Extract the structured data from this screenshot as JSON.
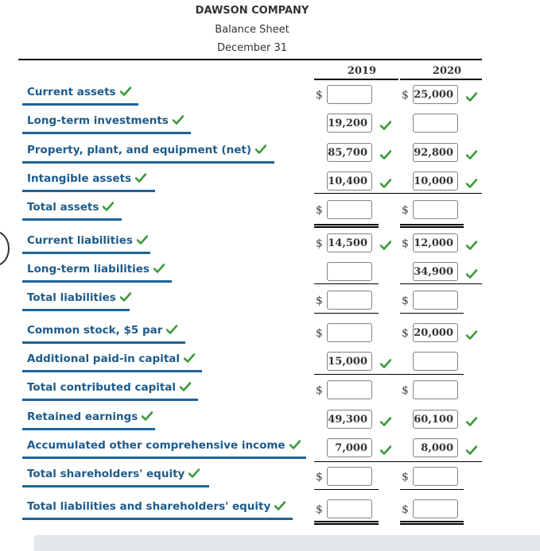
{
  "header": {
    "company": "DAWSON COMPANY",
    "statement": "Balance Sheet",
    "date": "December 31"
  },
  "columns": [
    "2019",
    "2020"
  ],
  "colors": {
    "label_text": "#1d5b8c",
    "label_underline": "#1f6399",
    "check_green": "#3a9a3a"
  },
  "rows": [
    {
      "label": "Current assets",
      "label_checked": true,
      "y2019": {
        "dollar": true,
        "value": "",
        "checked": false
      },
      "y2020": {
        "dollar": true,
        "value": "25,000",
        "checked": true
      }
    },
    {
      "label": "Long-term investments",
      "label_checked": true,
      "y2019": {
        "dollar": false,
        "value": "19,200",
        "checked": true
      },
      "y2020": {
        "dollar": false,
        "value": "",
        "checked": false
      }
    },
    {
      "label": "Property, plant, and equipment (net)",
      "label_checked": true,
      "y2019": {
        "dollar": false,
        "value": "85,700",
        "checked": true
      },
      "y2020": {
        "dollar": false,
        "value": "92,800",
        "checked": true
      }
    },
    {
      "label": "Intangible assets",
      "label_checked": true,
      "y2019": {
        "dollar": false,
        "value": "10,400",
        "checked": true
      },
      "y2020": {
        "dollar": false,
        "value": "10,000",
        "checked": true
      }
    },
    {
      "label": "Total assets",
      "label_checked": true,
      "y2019": {
        "dollar": true,
        "value": "",
        "checked": false
      },
      "y2020": {
        "dollar": true,
        "value": "",
        "checked": false
      }
    },
    {
      "label": "Current liabilities",
      "label_checked": true,
      "y2019": {
        "dollar": true,
        "value": "14,500",
        "checked": true
      },
      "y2020": {
        "dollar": true,
        "value": "12,000",
        "checked": true
      }
    },
    {
      "label": "Long-term liabilities",
      "label_checked": true,
      "y2019": {
        "dollar": false,
        "value": "",
        "checked": false
      },
      "y2020": {
        "dollar": false,
        "value": "34,900",
        "checked": true
      }
    },
    {
      "label": "Total liabilities",
      "label_checked": true,
      "y2019": {
        "dollar": true,
        "value": "",
        "checked": false
      },
      "y2020": {
        "dollar": true,
        "value": "",
        "checked": false
      }
    },
    {
      "label": "Common stock, $5 par",
      "label_checked": true,
      "y2019": {
        "dollar": true,
        "value": "",
        "checked": false
      },
      "y2020": {
        "dollar": true,
        "value": "20,000",
        "checked": true
      }
    },
    {
      "label": "Additional paid-in capital",
      "label_checked": true,
      "y2019": {
        "dollar": false,
        "value": "15,000",
        "checked": true
      },
      "y2020": {
        "dollar": false,
        "value": "",
        "checked": false
      }
    },
    {
      "label": "Total contributed capital",
      "label_checked": true,
      "y2019": {
        "dollar": true,
        "value": "",
        "checked": false
      },
      "y2020": {
        "dollar": true,
        "value": "",
        "checked": false
      }
    },
    {
      "label": "Retained earnings",
      "label_checked": true,
      "y2019": {
        "dollar": false,
        "value": "49,300",
        "checked": true
      },
      "y2020": {
        "dollar": false,
        "value": "60,100",
        "checked": true
      }
    },
    {
      "label": "Accumulated other comprehensive income",
      "label_checked": true,
      "y2019": {
        "dollar": false,
        "value": "7,000",
        "checked": true
      },
      "y2020": {
        "dollar": false,
        "value": "8,000",
        "checked": true
      }
    },
    {
      "label": "Total shareholders' equity",
      "label_checked": true,
      "y2019": {
        "dollar": true,
        "value": "",
        "checked": false
      },
      "y2020": {
        "dollar": true,
        "value": "",
        "checked": false
      }
    },
    {
      "label": "Total liabilities and shareholders' equity",
      "label_checked": true,
      "y2019": {
        "dollar": true,
        "value": "",
        "checked": false
      },
      "y2020": {
        "dollar": true,
        "value": "",
        "checked": false
      }
    }
  ],
  "currency_symbol": "$"
}
